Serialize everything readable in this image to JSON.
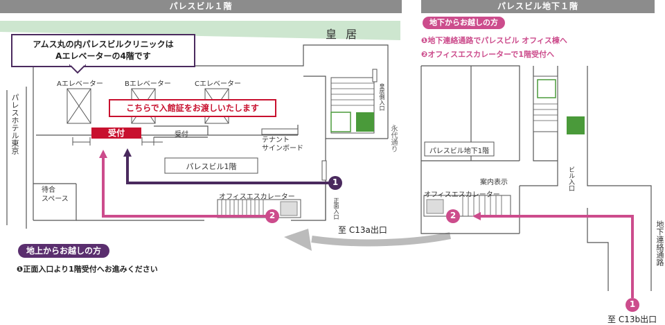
{
  "headers": {
    "left": "パレスビル１階",
    "right": "パレスビル地下１階"
  },
  "left_map": {
    "imperial_palace": "皇 居",
    "callout": {
      "line1": "アムス丸の内パレスビルクリニックは",
      "line2": "Aエレベーターの4階です"
    },
    "notice": "こちらで入館証をお渡しいたします",
    "elevators": [
      "Aエレベーター",
      "Bエレベーター",
      "Cエレベーター"
    ],
    "reception_main": "受付",
    "reception_small": "受付",
    "tenant_board": {
      "line1": "テナント",
      "line2": "サインボード"
    },
    "building_label": "パレスビル1階",
    "hotel_label": "パレスホテル東京",
    "waiting": {
      "line1": "待合",
      "line2": "スペース"
    },
    "escalator": "オフィスエスカレーター",
    "palace_side_entrance": "皇居側入口",
    "street": "永代通り",
    "front_entrance": "正面入口",
    "exit_label": "至 C13a出口"
  },
  "right_map": {
    "basement_label": "パレスビル地下1階",
    "info_display": "案内表示",
    "escalator": "オフィスエスカレーター",
    "building_entrance": "ビル入口",
    "passage": "地下連絡通路",
    "exit_label": "至 C13b出口"
  },
  "basement_instructions": {
    "title": "地下からお越しの方",
    "steps": [
      "❶地下連絡通路でパレスビル オフィス棟へ",
      "❷オフィスエスカレーターで1階受付へ"
    ]
  },
  "ground_instructions": {
    "title": "地上からお越しの方",
    "steps": [
      "❶正面入口より1階受付へお進みください"
    ]
  },
  "markers": {
    "one": "1",
    "two": "2"
  },
  "colors": {
    "purple": "#4a2a5e",
    "pink": "#cc4c8c",
    "red": "#c8102e",
    "green": "#4a9a3a",
    "palace_band": "#cde6cf",
    "gray_arrow": "#b5b5b5"
  }
}
